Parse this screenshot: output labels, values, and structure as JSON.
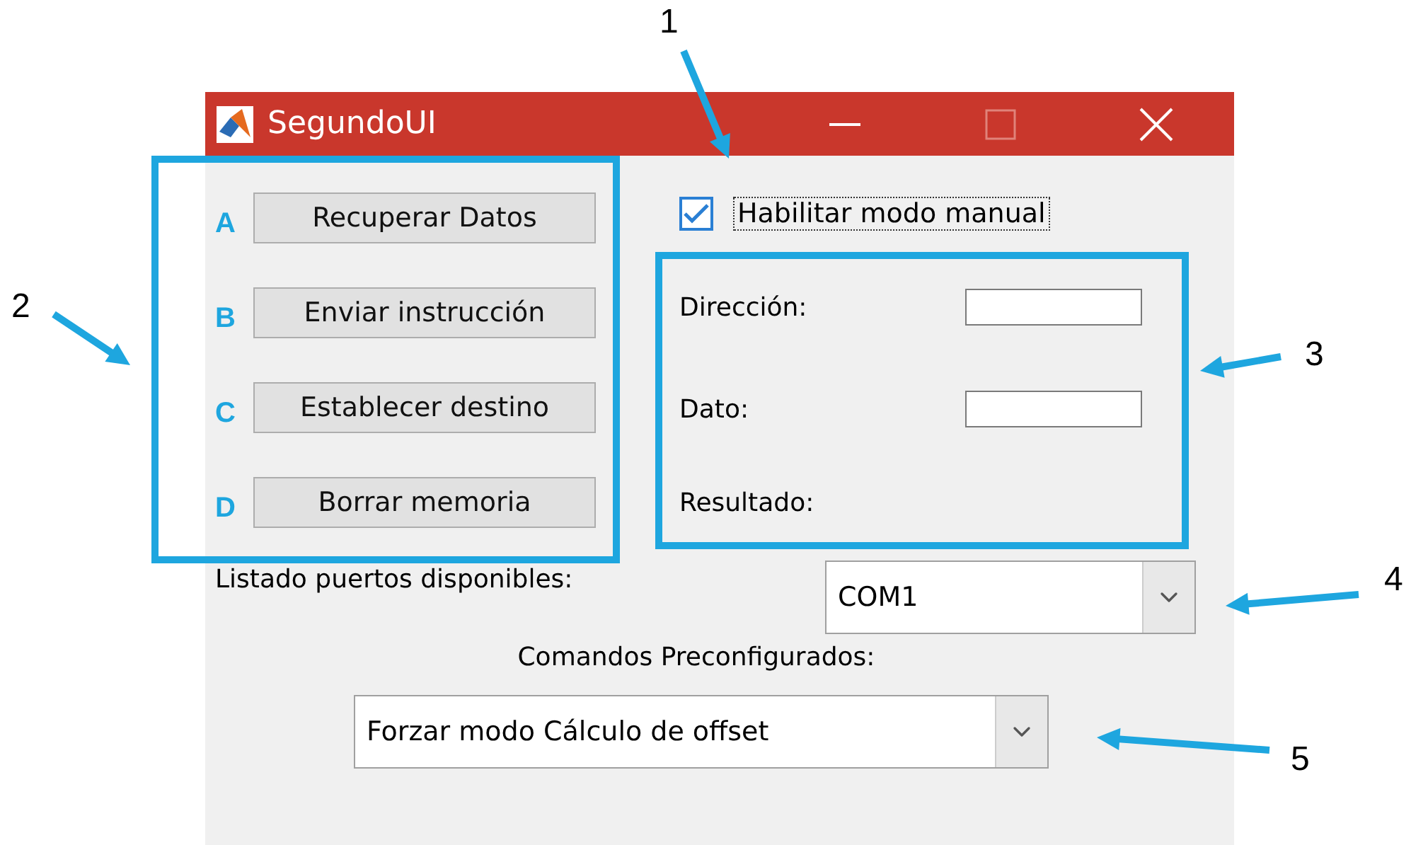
{
  "window": {
    "title": "SegundoUI"
  },
  "buttons": [
    {
      "letter": "A",
      "label": "Recuperar Datos"
    },
    {
      "letter": "B",
      "label": "Enviar instrucción"
    },
    {
      "letter": "C",
      "label": "Establecer destino"
    },
    {
      "letter": "D",
      "label": "Borrar memoria"
    }
  ],
  "manual_mode": {
    "label": "Habilitar modo manual",
    "checked": true
  },
  "fields": [
    {
      "label": "Dirección:",
      "kind": "input"
    },
    {
      "label": "Dato:",
      "kind": "input"
    },
    {
      "label": "Resultado:",
      "kind": "output"
    }
  ],
  "ports": {
    "label": "Listado puertos disponibles:",
    "value": "COM1"
  },
  "commands": {
    "label": "Comandos Preconfigurados:",
    "value": "Forzar modo Cálculo de offset"
  },
  "callouts": [
    "1",
    "2",
    "3",
    "4",
    "5"
  ]
}
